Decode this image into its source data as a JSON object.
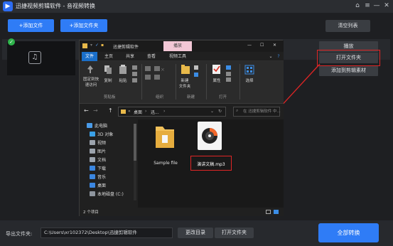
{
  "app": {
    "title": "迅捷视频剪辑软件 - 音视频转换",
    "logo_glyph": "▶"
  },
  "window_controls": {
    "home": "⌂",
    "menu": "≡",
    "minimize": "—",
    "close": "✕"
  },
  "toolbar": {
    "add_file": "+添加文件",
    "add_folder": "+添加文件夹",
    "clear_list": "清空列表"
  },
  "file_item": {
    "check": "✓",
    "thumb_glyph": "♫",
    "play": "播放",
    "open_folder": "打开文件夹",
    "add_to_material": "添加到剪辑素材"
  },
  "explorer": {
    "title_path": "迅捷剪辑软件",
    "title_tab_play": "播放",
    "title_controls": {
      "minimize": "—",
      "maximize": "☐",
      "close": "✕"
    },
    "tabs": [
      "文件",
      "主页",
      "共享",
      "查看",
      "视频工具"
    ],
    "ribbon": {
      "pin_label": "固定到快\n速访问",
      "copy": "复制",
      "paste": "粘贴",
      "clipboard": "剪贴板",
      "organize": "组织",
      "new_folder": "新建\n文件夹",
      "new": "新建",
      "properties": "属性",
      "open": "打开",
      "select": "选择"
    },
    "address": {
      "seg1": "桌面",
      "seg2": "迅...",
      "back": "←",
      "forward": "→",
      "up": "↑"
    },
    "search_placeholder": "在 迅捷剪辑软件 中...",
    "nav": [
      {
        "label": "此电脑",
        "color": "#4a9be8"
      },
      {
        "label": "3D 对象",
        "color": "#3aa0e6"
      },
      {
        "label": "视频",
        "color": "#9ba3ad"
      },
      {
        "label": "图片",
        "color": "#9ba3ad"
      },
      {
        "label": "文档",
        "color": "#9ba3ad"
      },
      {
        "label": "下载",
        "color": "#3b86e0"
      },
      {
        "label": "音乐",
        "color": "#3b86e0"
      },
      {
        "label": "桌面",
        "color": "#3b86e0"
      },
      {
        "label": "本地磁盘 (C:)",
        "color": "#8e959e"
      }
    ],
    "files": [
      {
        "name": "Sample file"
      },
      {
        "name": "演讲文稿.mp3"
      }
    ],
    "status_count": "2 个项目"
  },
  "bottom": {
    "export_label": "导出文件夹:",
    "export_path": "C:\\Users\\xr102372\\Desktop\\迅捷剪辑软件",
    "change_dir": "更改目录",
    "open_dir": "打开文件夹",
    "convert_all": "全部转换"
  }
}
